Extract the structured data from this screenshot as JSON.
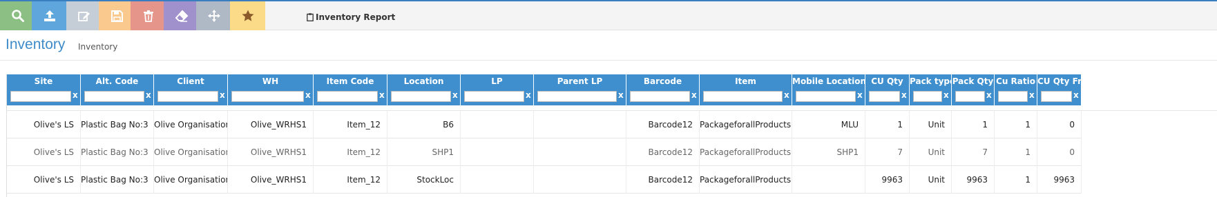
{
  "toolbar": {
    "buttons": [
      {
        "name": "search-button",
        "icon": "search-icon",
        "color": "#8bbf84"
      },
      {
        "name": "upload-button",
        "icon": "upload-icon",
        "color": "#5fa6dd"
      },
      {
        "name": "edit-button",
        "icon": "edit-icon",
        "color": "#c5cdd6"
      },
      {
        "name": "save-button",
        "icon": "save-icon",
        "color": "#f9c98d"
      },
      {
        "name": "delete-button",
        "icon": "trash-icon",
        "color": "#e5958a"
      },
      {
        "name": "clear-button",
        "icon": "eraser-icon",
        "color": "#a090cc"
      },
      {
        "name": "move-button",
        "icon": "move-icon",
        "color": "#aeb9c5"
      },
      {
        "name": "favorite-button",
        "icon": "star-icon",
        "color": "#fbdb87"
      }
    ],
    "report_label": "Inventory Report"
  },
  "page": {
    "title": "Inventory",
    "subtitle": "Inventory"
  },
  "colors": {
    "accent": "#3f8fcf",
    "title": "#3f8cc9"
  },
  "grid": {
    "columns": [
      {
        "label": "Site"
      },
      {
        "label": "Alt. Code"
      },
      {
        "label": "Client"
      },
      {
        "label": "WH"
      },
      {
        "label": "Item Code"
      },
      {
        "label": "Location"
      },
      {
        "label": "LP"
      },
      {
        "label": "Parent LP"
      },
      {
        "label": "Barcode"
      },
      {
        "label": "Item"
      },
      {
        "label": "Mobile Location Uni"
      },
      {
        "label": "CU Qty"
      },
      {
        "label": "Pack type"
      },
      {
        "label": "Pack Qty"
      },
      {
        "label": "Cu Ratio"
      },
      {
        "label": "CU Qty Fre"
      }
    ],
    "filter_clear_label": "x",
    "rows": [
      [
        "Olive's LS",
        "Plastic Bag No:3",
        "Olive Organisation",
        "Olive_WRHS1",
        "Item_12",
        "B6",
        "",
        "",
        "Barcode12",
        "PackageforallProducts",
        "MLU",
        "1",
        "Unit",
        "1",
        "1",
        "0"
      ],
      [
        "Olive's LS",
        "Plastic Bag No:3",
        "Olive Organisation",
        "Olive_WRHS1",
        "Item_12",
        "SHP1",
        "",
        "",
        "Barcode12",
        "PackageforallProducts",
        "SHP1",
        "7",
        "Unit",
        "7",
        "1",
        "0"
      ],
      [
        "Olive's LS",
        "Plastic Bag No:3",
        "Olive Organisation",
        "Olive_WRHS1",
        "Item_12",
        "StockLoc",
        "",
        "",
        "Barcode12",
        "PackageforallProducts",
        "",
        "9963",
        "Unit",
        "9963",
        "1",
        "9963"
      ]
    ]
  }
}
